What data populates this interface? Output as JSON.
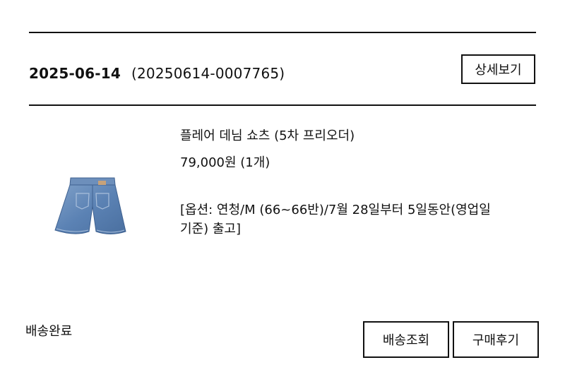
{
  "order": {
    "date": "2025-06-14",
    "number": "(20250614-0007765)",
    "detail_button": "상세보기"
  },
  "product": {
    "image_icon": "denim-shorts-image",
    "name": "플레어 데님 쇼츠 (5차 프리오더)",
    "price": "79,000원 (1개)",
    "options_line1": "[옵션: 연청/M (66~66반)/7월 28일부터 5일동안(영업일",
    "options_line2": "기준) 출고]"
  },
  "shipping": {
    "status": "배송완료",
    "track_button": "배송조회",
    "review_button": "구매후기"
  },
  "colors": {
    "line": "#111111",
    "denim": "#5b82b4"
  }
}
